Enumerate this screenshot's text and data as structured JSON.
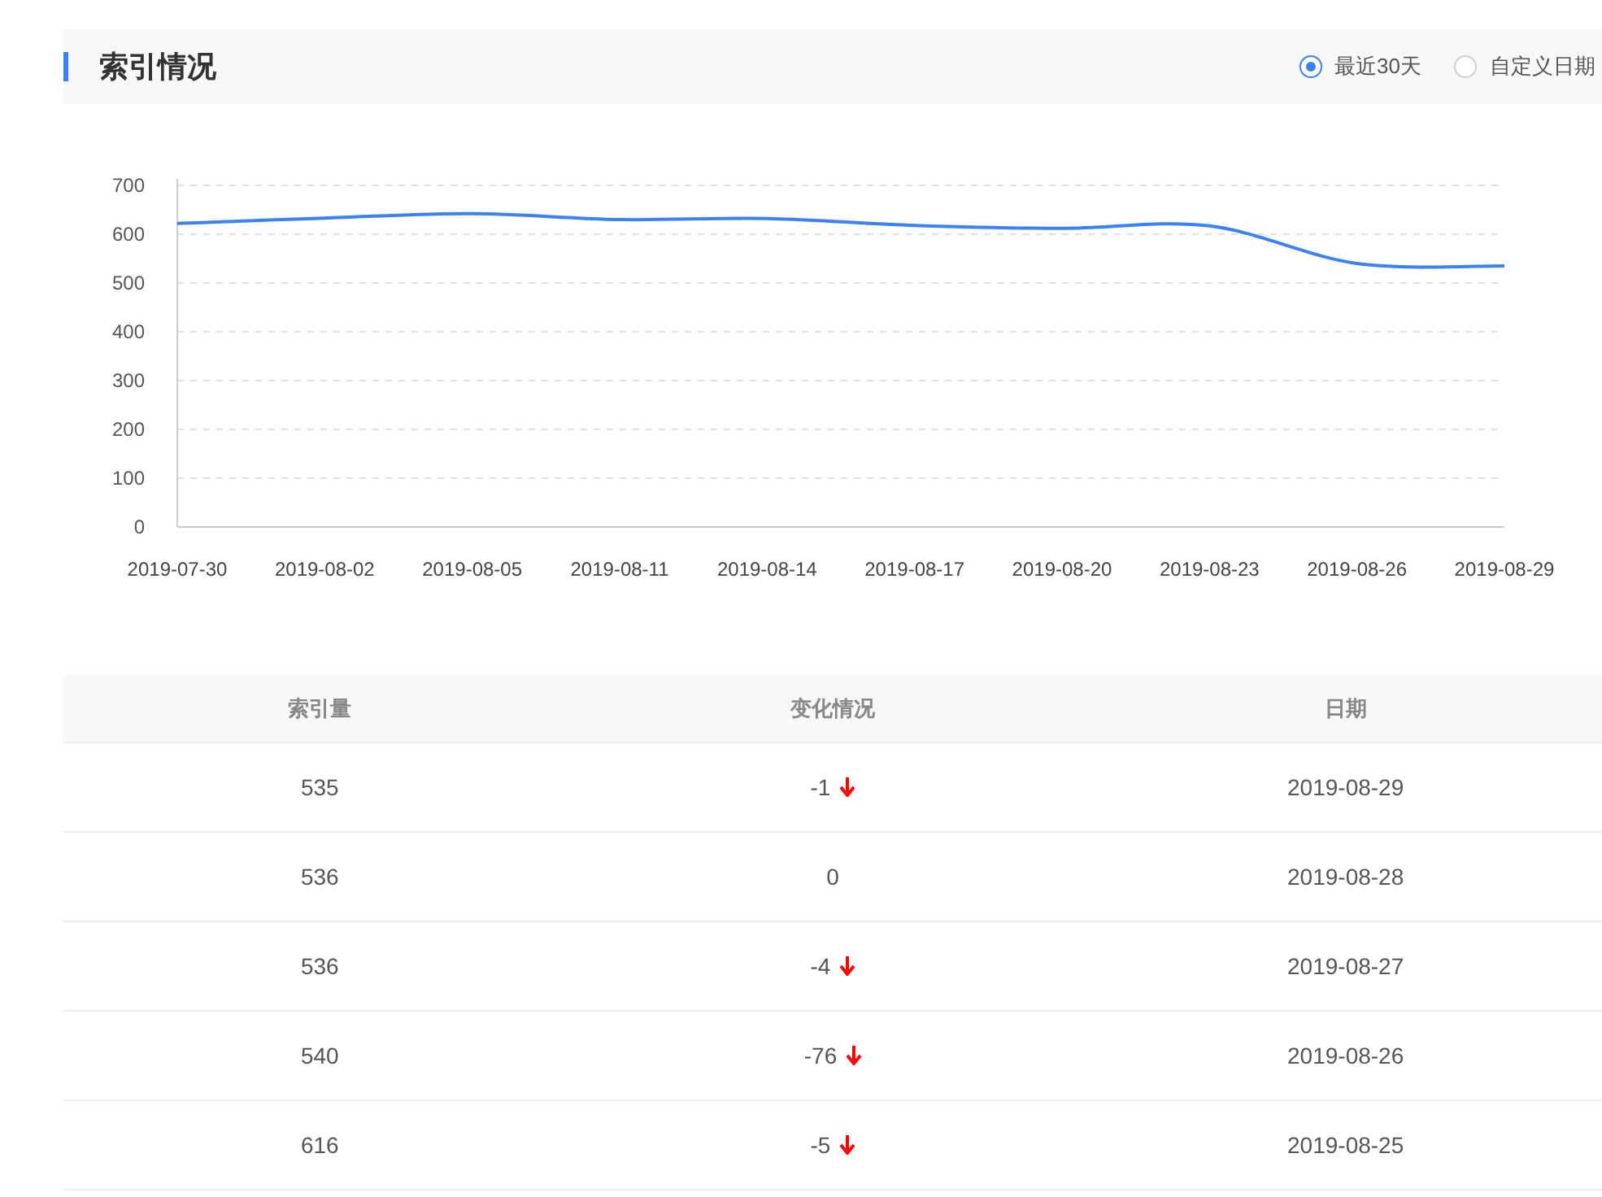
{
  "header": {
    "title": "索引情况",
    "options": [
      {
        "label": "最近30天",
        "selected": true
      },
      {
        "label": "自定义日期",
        "selected": false
      }
    ]
  },
  "chart": {
    "chart_data": {
      "type": "line",
      "grid": true,
      "categories": [
        "2019-07-30",
        "2019-08-02",
        "2019-08-05",
        "2019-08-11",
        "2019-08-14",
        "2019-08-17",
        "2019-08-20",
        "2019-08-23",
        "2019-08-26",
        "2019-08-29"
      ],
      "series": [
        {
          "color": "#3b82f6",
          "values": [
            622,
            633,
            642,
            630,
            632,
            618,
            612,
            617,
            540,
            535
          ]
        }
      ],
      "ylim": [
        0,
        700
      ],
      "yticks": [
        0,
        100,
        200,
        300,
        400,
        500,
        600,
        700
      ]
    }
  },
  "table": {
    "columns": [
      "索引量",
      "变化情况",
      "日期"
    ],
    "rows": [
      {
        "count": "535",
        "change": "-1",
        "kind": "down",
        "date": "2019-08-29"
      },
      {
        "count": "536",
        "change": "0",
        "kind": "flat",
        "date": "2019-08-28"
      },
      {
        "count": "536",
        "change": "-4",
        "kind": "down",
        "date": "2019-08-27"
      },
      {
        "count": "540",
        "change": "-76",
        "kind": "down",
        "date": "2019-08-26"
      },
      {
        "count": "616",
        "change": "-5",
        "kind": "down",
        "date": "2019-08-25"
      }
    ]
  }
}
